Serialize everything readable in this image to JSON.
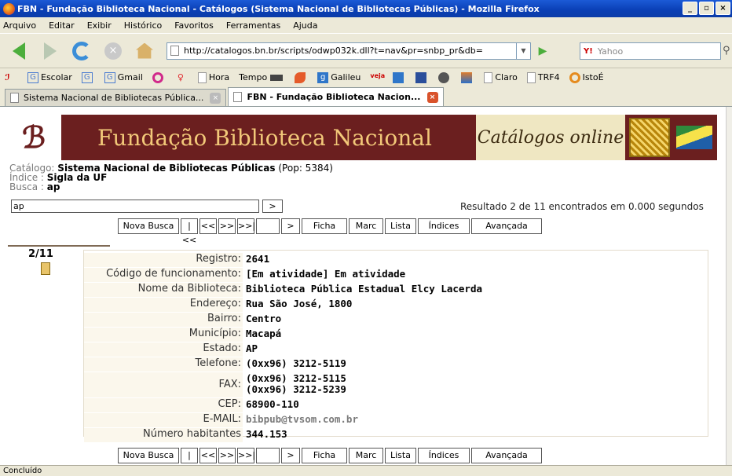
{
  "window": {
    "title": "FBN - Fundação Biblioteca Nacional - Catálogos (Sistema Nacional de Bibliotecas Públicas) - Mozilla Firefox"
  },
  "menu": [
    "Arquivo",
    "Editar",
    "Exibir",
    "Histórico",
    "Favoritos",
    "Ferramentas",
    "Ajuda"
  ],
  "address": {
    "url": "http://catalogos.bn.br/scripts/odwp032k.dll?t=nav&pr=snbp_pr&db="
  },
  "search": {
    "engine": "Y!",
    "placeholder": "Yahoo"
  },
  "bookmarks": [
    "Escolar",
    "Gmail",
    "Hora",
    "Tempo",
    "Galileu",
    "Claro",
    "TRF4",
    "IstoÉ"
  ],
  "tabs": [
    {
      "label": "Sistema Nacional de Bibliotecas Pública..."
    },
    {
      "label": "FBN - Fundação Biblioteca Nacion..."
    }
  ],
  "banner": {
    "title": "Fundação Biblioteca Nacional",
    "catalog": "Catálogos online"
  },
  "info": {
    "catalog_label": "Catálogo:",
    "catalog_value": "Sistema Nacional de Bibliotecas Públicas",
    "catalog_pop": "(Pop: 5384)",
    "index_label": "Índice :",
    "index_value": "Sigla da UF",
    "query_label": "Busca :",
    "query_value": "ap"
  },
  "searchrow": {
    "value": "ap",
    "go": ">"
  },
  "result_text": "Resultado 2 de 11 encontrados em 0.000 segundos",
  "buttons": {
    "nova": "Nova Busca",
    "first": "|<<",
    "prev": "<<",
    "next": ">>",
    "last": ">>|",
    "go": ">",
    "ficha": "Ficha",
    "marc": "Marc",
    "lista": "Lista",
    "indices": "Índices",
    "avancada": "Avançada"
  },
  "record": {
    "count": "2/11",
    "fields": [
      {
        "k": "Registro:",
        "v": "2641"
      },
      {
        "k": "Código de funcionamento:",
        "v": "[Em atividade] Em atividade"
      },
      {
        "k": "Nome da Biblioteca:",
        "v": "Biblioteca Pública Estadual Elcy Lacerda"
      },
      {
        "k": "Endereço:",
        "v": "Rua São José, 1800"
      },
      {
        "k": "Bairro:",
        "v": "Centro"
      },
      {
        "k": "Município:",
        "v": "Macapá"
      },
      {
        "k": "Estado:",
        "v": "AP"
      },
      {
        "k": "Telefone:",
        "v": "(0xx96) 3212-5119"
      },
      {
        "k": "FAX:",
        "v": "(0xx96) 3212-5115",
        "v2": "(0xx96) 3212-5239"
      },
      {
        "k": "CEP:",
        "v": "68900-110"
      },
      {
        "k": "E-MAIL:",
        "v": "bibpub@tvsom.com.br"
      },
      {
        "k": "Número habitantes",
        "v": "344.153"
      }
    ]
  },
  "status": "Concluído"
}
